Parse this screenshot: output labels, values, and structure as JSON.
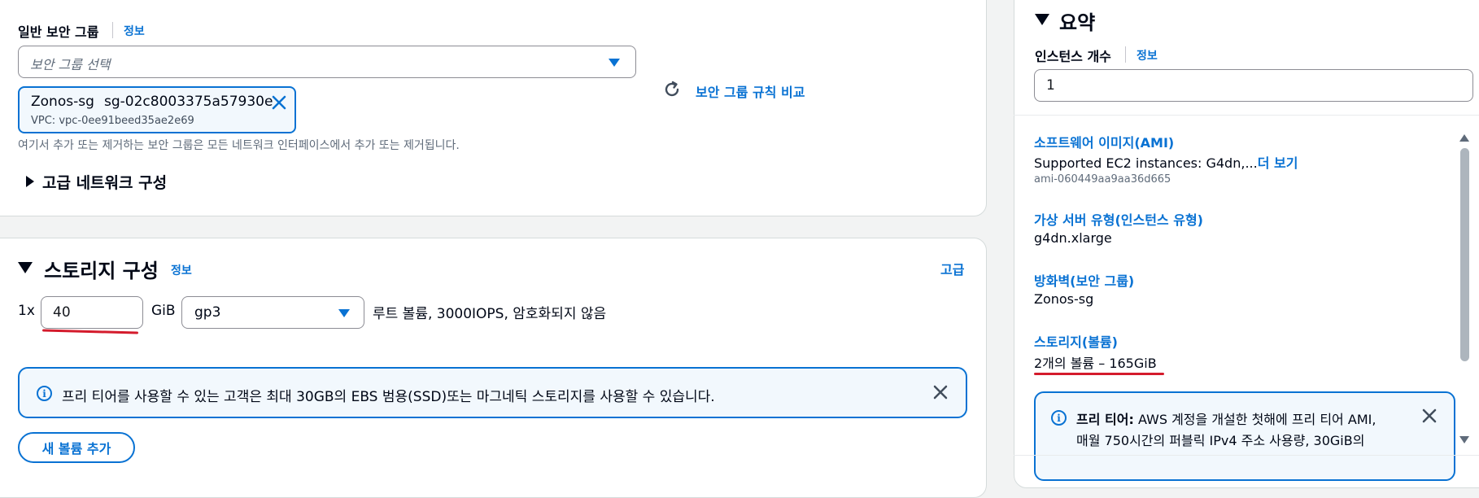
{
  "network": {
    "sg_label": "일반 보안 그룹",
    "sg_info": "정보",
    "sg_placeholder": "보안 그룹 선택",
    "token_name": "Zonos-sg",
    "token_id": "sg-02c8003375a57930e",
    "token_vpc": "VPC: vpc-0ee91beed35ae2e69",
    "compare_label": "보안 그룹 규칙 비교",
    "desc": "여기서 추가 또는 제거하는 보안 그룹은 모든 네트워크 인터페이스에서 추가 또는 제거됩니다.",
    "advanced_label": "고급 네트워크 구성"
  },
  "storage": {
    "title": "스토리지 구성",
    "info": "정보",
    "advanced": "고급",
    "multiplier": "1x",
    "size_value": "40",
    "unit": "GiB",
    "volume_type": "gp3",
    "root_desc": "루트 볼륨,  3000IOPS,  암호화되지 않음",
    "free_tier_msg": "프리 티어를 사용할 수 있는 고객은 최대 30GB의 EBS 범용(SSD)또는 마그네틱 스토리지를 사용할 수 있습니다.",
    "add_volume": "새 볼륨 추가"
  },
  "summary": {
    "title": "요약",
    "count_label": "인스턴스 개수",
    "count_info": "정보",
    "count_value": "1",
    "ami_label": "소프트웨어 이미지(AMI)",
    "ami_value": "Supported EC2 instances: G4dn,...",
    "ami_more": "더 보기",
    "ami_id": "ami-060449aa9aa36d665",
    "type_label": "가상 서버 유형(인스턴스 유형)",
    "type_value": "g4dn.xlarge",
    "fw_label": "방화벽(보안 그룹)",
    "fw_value": "Zonos-sg",
    "storage_label": "스토리지(볼륨)",
    "storage_value": "2개의 볼륨 – 165GiB",
    "free_tier_bold": "프리 티어:",
    "free_tier_line1": " AWS 계정을 개설한 첫해에 프리 티어 AMI,",
    "free_tier_line2": "매월 750시간의 퍼블릭 IPv4 주소 사용량, 30GiB의"
  },
  "colors": {
    "accent": "#0972d3",
    "annotation": "#d41b2c",
    "alert_bg": "#f2f8fd"
  },
  "icons": [
    "chevron-down-icon",
    "close-icon",
    "refresh-icon",
    "info-icon",
    "caret-right-icon",
    "scroll-up-icon",
    "scroll-down-icon"
  ]
}
